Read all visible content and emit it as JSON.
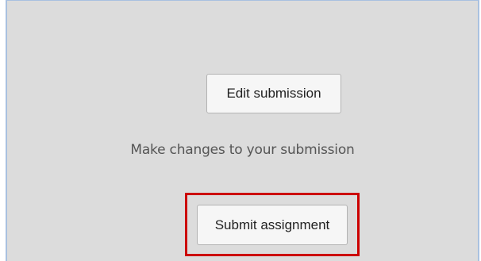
{
  "submission": {
    "edit_label": "Edit submission",
    "edit_help": "Make changes to your submission",
    "submit_label": "Submit assignment",
    "highlight_color": "#cc0000"
  }
}
